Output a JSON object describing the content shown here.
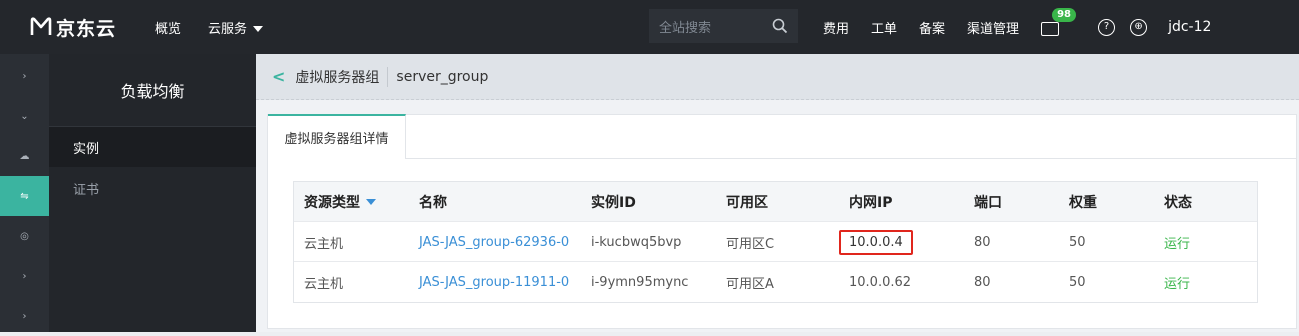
{
  "topbar": {
    "brand": "京东云",
    "nav": [
      {
        "label": "概览"
      },
      {
        "label": "云服务"
      }
    ],
    "search_placeholder": "全站搜索",
    "right": [
      {
        "label": "费用"
      },
      {
        "label": "工单"
      },
      {
        "label": "备案"
      },
      {
        "label": "渠道管理"
      }
    ],
    "mail_badge": "98",
    "help_glyph": "?",
    "globe_glyph": "⊕",
    "user": "jdc-12"
  },
  "rail": {
    "items": [
      {
        "icon": "chevron-right-icon",
        "glyph": "›"
      },
      {
        "icon": "chevron-down-icon",
        "glyph": "⌄"
      },
      {
        "icon": "cloud-icon",
        "glyph": "☁"
      },
      {
        "icon": "load-balance-icon",
        "glyph": "⇋"
      },
      {
        "icon": "network-icon",
        "glyph": "◎"
      },
      {
        "icon": "chevron-right-icon",
        "glyph": "›"
      },
      {
        "icon": "chevron-right-icon",
        "glyph": "›"
      }
    ]
  },
  "sidebar": {
    "title": "负载均衡",
    "items": [
      {
        "label": "实例"
      },
      {
        "label": "证书"
      }
    ]
  },
  "breadcrumb": {
    "section": "虚拟服务器组",
    "name": "server_group"
  },
  "tab": {
    "label": "虚拟服务器组详情"
  },
  "table": {
    "headers": [
      "资源类型",
      "名称",
      "实例ID",
      "可用区",
      "内网IP",
      "端口",
      "权重",
      "状态"
    ],
    "rows": [
      {
        "type": "云主机",
        "name": "JAS-JAS_group-62936-0",
        "id": "i-kucbwq5bvp",
        "zone": "可用区C",
        "ip": "10.0.0.4",
        "port": "80",
        "weight": "50",
        "status": "运行"
      },
      {
        "type": "云主机",
        "name": "JAS-JAS_group-11911-0",
        "id": "i-9ymn95mync",
        "zone": "可用区A",
        "ip": "10.0.0.62",
        "port": "80",
        "weight": "50",
        "status": "运行"
      }
    ]
  },
  "colors": {
    "accent": "#3bb4a0",
    "link": "#3a8fd6",
    "running": "#39b54a",
    "highlight": "#e0261d"
  }
}
